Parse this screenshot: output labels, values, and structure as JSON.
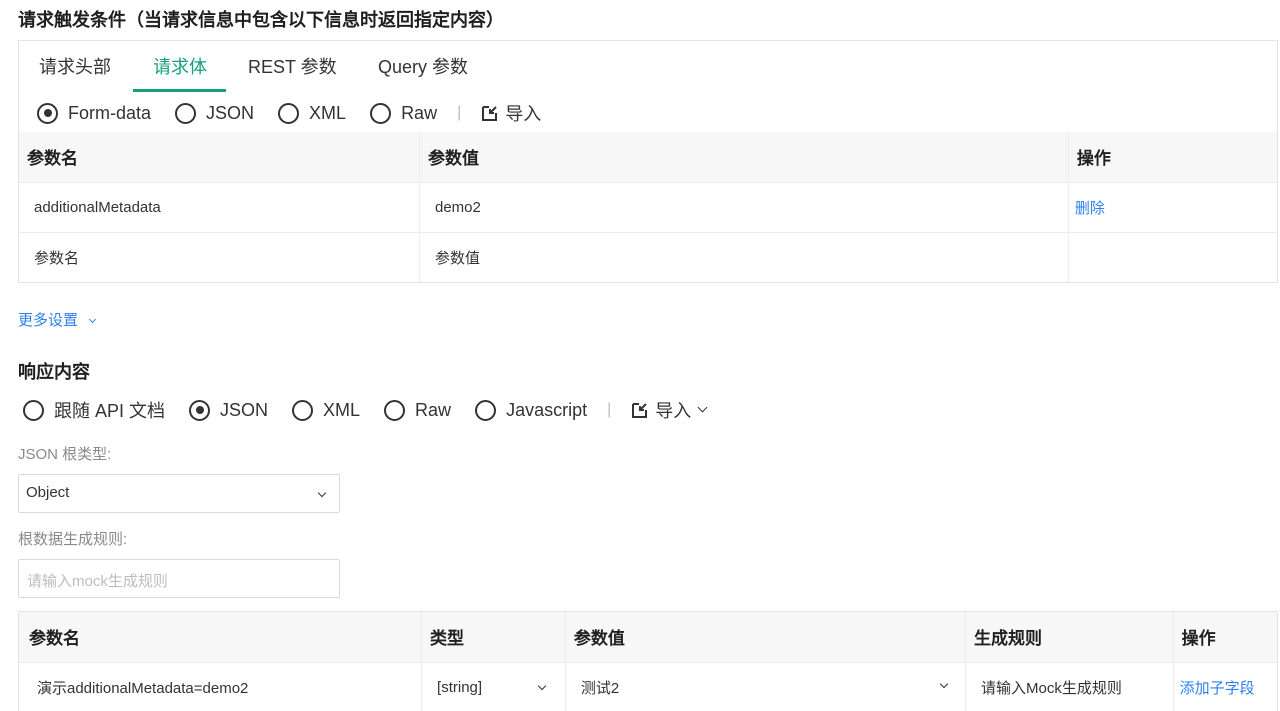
{
  "request": {
    "title": "请求触发条件（当请求信息中包含以下信息时返回指定内容）",
    "tabs": [
      {
        "label": "请求头部",
        "active": false
      },
      {
        "label": "请求体",
        "active": true
      },
      {
        "label": "REST 参数",
        "active": false
      },
      {
        "label": "Query 参数",
        "active": false
      }
    ],
    "body_types": [
      {
        "label": "Form-data",
        "checked": true
      },
      {
        "label": "JSON",
        "checked": false
      },
      {
        "label": "XML",
        "checked": false
      },
      {
        "label": "Raw",
        "checked": false
      }
    ],
    "separator": "|",
    "import_label": "导入",
    "table": {
      "headers": [
        "参数名",
        "参数值",
        "操作"
      ],
      "rows": [
        {
          "name": "additionalMetadata",
          "value": "demo2",
          "action": "删除"
        }
      ],
      "new_row": {
        "name_placeholder": "参数名",
        "value_placeholder": "参数值"
      }
    }
  },
  "more_settings": "更多设置",
  "response": {
    "title": "响应内容",
    "types": [
      {
        "label": "跟随 API 文档",
        "checked": false
      },
      {
        "label": "JSON",
        "checked": true
      },
      {
        "label": "XML",
        "checked": false
      },
      {
        "label": "Raw",
        "checked": false
      },
      {
        "label": "Javascript",
        "checked": false
      }
    ],
    "separator": "|",
    "import_label": "导入",
    "root_type_label": "JSON 根类型:",
    "root_type_value": "Object",
    "root_rule_label": "根数据生成规则:",
    "root_rule_placeholder": "请输入mock生成规则",
    "table": {
      "headers": [
        "参数名",
        "类型",
        "参数值",
        "生成规则",
        "操作"
      ],
      "rows": [
        {
          "name": "演示additionalMetadata=demo2",
          "type": "[string]",
          "value": "测试2",
          "rule_placeholder": "请输入Mock生成规则",
          "action": "添加子字段"
        }
      ]
    }
  }
}
